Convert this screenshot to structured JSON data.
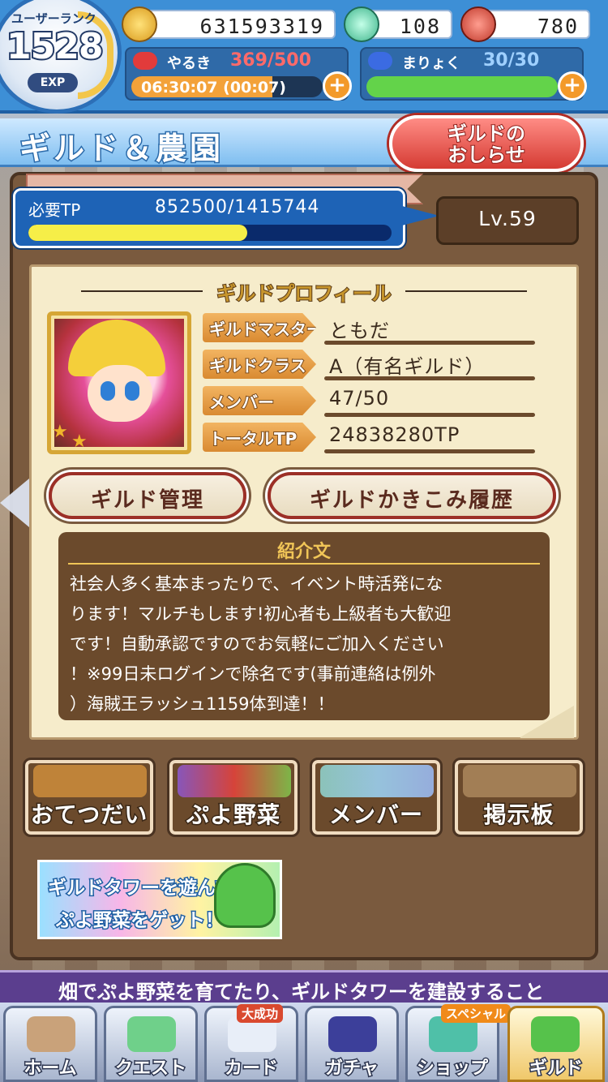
{
  "header": {
    "rank_label": "ユーザーランク",
    "rank": "1528",
    "exp_label": "EXP",
    "coins": "631593319",
    "gems": "108",
    "meat": "780",
    "stamina_label": "やるき",
    "stamina_value": "369/500",
    "stamina_timer": "06:30:07 (00:07)",
    "stamina_fraction": 0.738,
    "mana_label": "まりょく",
    "mana_value": "30/30",
    "mana_fraction": 1.0,
    "plus": "+"
  },
  "title": "ギルド＆農園",
  "news_button": "ギルドの\nおしらせ",
  "tp": {
    "label": "必要TP",
    "value": "852500/1415744",
    "fraction": 0.602
  },
  "level": "Lv.59",
  "profile": {
    "heading": "ギルドプロフィール",
    "fields": [
      {
        "tag": "ギルドマスター",
        "value": "ともだ"
      },
      {
        "tag": "ギルドクラス",
        "value": "A（有名ギルド）"
      },
      {
        "tag": "メンバー",
        "value": "47/50"
      },
      {
        "tag": "トータルTP",
        "value": "24838280TP"
      }
    ]
  },
  "buttons": {
    "manage": "ギルド管理",
    "history": "ギルドかきこみ履歴"
  },
  "intro": {
    "heading": "紹介文",
    "body": "社会人多く基本まったりで、イベント時活発にな\nります！マルチもします!初心者も上級者も大歓迎\nです！自動承認ですのでお気軽にご加入ください\n！※99日未ログインで除名です(事前連絡は例外\n）海賊王ラッシュ1159体到達！！"
  },
  "menu": [
    {
      "label": "おてつだい",
      "icon": "watering-can-icon"
    },
    {
      "label": "ぷよ野菜",
      "icon": "vegetables-icon"
    },
    {
      "label": "メンバー",
      "icon": "members-icon"
    },
    {
      "label": "掲示板",
      "icon": "bulletin-board-icon"
    }
  ],
  "banner": {
    "line1": "ギルドタワーを遊んで",
    "line2": "ぷよ野菜をゲット！"
  },
  "ticker": "畑でぷよ野菜を育てたり、ギルドタワーを建設すること",
  "nav": [
    {
      "label": "ホーム",
      "icon": "home-icon"
    },
    {
      "label": "クエスト",
      "icon": "quest-icon"
    },
    {
      "label": "カード",
      "icon": "card-icon",
      "badge": "大成功"
    },
    {
      "label": "ガチャ",
      "icon": "gacha-icon"
    },
    {
      "label": "ショップ",
      "icon": "shop-icon",
      "badge": "スペシャル"
    },
    {
      "label": "ギルド",
      "icon": "guild-icon"
    }
  ],
  "colors": {
    "header_blue": "#3d8fd6",
    "board_brown": "#7a5a3e",
    "tp_fill": "#f6ee48",
    "stamina_fill": "#f3a23a",
    "mana_fill": "#63d34a"
  }
}
